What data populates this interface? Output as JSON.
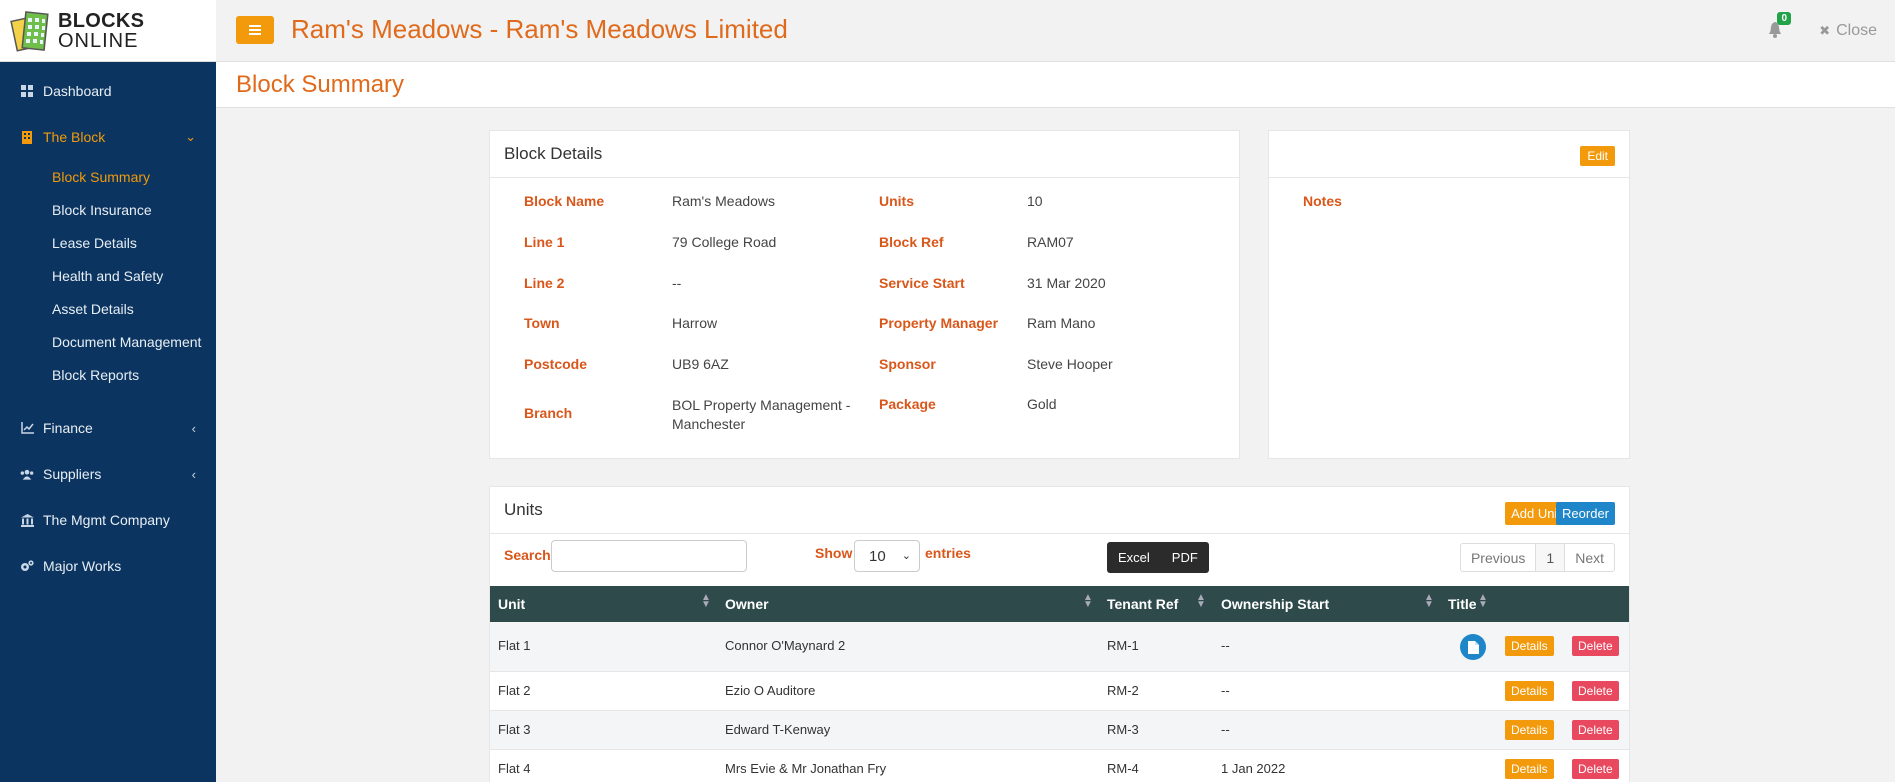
{
  "logo": {
    "line1": "BLOCKS",
    "line2": "ONLINE"
  },
  "sidebar": {
    "dashboard": "Dashboard",
    "the_block": "The Block",
    "sub_items": [
      "Block Summary",
      "Block Insurance",
      "Lease Details",
      "Health and Safety",
      "Asset Details",
      "Document Management",
      "Block Reports"
    ],
    "finance": "Finance",
    "suppliers": "Suppliers",
    "mgmt_company": "The Mgmt Company",
    "major_works": "Major Works"
  },
  "topbar": {
    "title": "Ram's Meadows - Ram's Meadows Limited",
    "notification_count": "0",
    "close_label": "Close"
  },
  "page": {
    "title": "Block Summary"
  },
  "block_details": {
    "heading": "Block Details",
    "labels": {
      "block_name": "Block Name",
      "line1": "Line 1",
      "line2": "Line 2",
      "town": "Town",
      "postcode": "Postcode",
      "branch": "Branch",
      "units": "Units",
      "block_ref": "Block Ref",
      "service_start": "Service Start",
      "property_manager": "Property Manager",
      "sponsor": "Sponsor",
      "package": "Package"
    },
    "values": {
      "block_name": "Ram's Meadows",
      "line1": "79 College Road",
      "line2": "--",
      "town": "Harrow",
      "postcode": "UB9 6AZ",
      "branch": "BOL Property Management - Manchester",
      "units": "10",
      "block_ref": "RAM07",
      "service_start": "31 Mar 2020",
      "property_manager": "Ram Mano",
      "sponsor": "Steve Hooper",
      "package": "Gold"
    }
  },
  "notes": {
    "edit_label": "Edit",
    "label": "Notes"
  },
  "units_panel": {
    "heading": "Units",
    "add_unit": "Add Unit",
    "reorder": "Reorder",
    "search_label": "Search",
    "search_value": "",
    "show_label": "Show",
    "show_value": "10",
    "entries_label": "entries",
    "excel": "Excel",
    "pdf": "PDF",
    "pager": {
      "previous": "Previous",
      "page": "1",
      "next": "Next"
    },
    "columns": [
      "Unit",
      "Owner",
      "Tenant Ref",
      "Ownership Start",
      "Title"
    ],
    "rows": [
      {
        "unit": "Flat 1",
        "owner": "Connor O'Maynard 2",
        "tenant_ref": "RM-1",
        "ownership_start": "--"
      },
      {
        "unit": "Flat 2",
        "owner": "Ezio O Auditore",
        "tenant_ref": "RM-2",
        "ownership_start": "--"
      },
      {
        "unit": "Flat 3",
        "owner": "Edward T-Kenway",
        "tenant_ref": "RM-3",
        "ownership_start": "--"
      },
      {
        "unit": "Flat 4",
        "owner": "Mrs Evie & Mr Jonathan Fry",
        "tenant_ref": "RM-4",
        "ownership_start": "1 Jan 2022"
      }
    ],
    "details_label": "Details",
    "delete_label": "Delete"
  },
  "colors": {
    "accent": "#f29a0b",
    "title": "#e06a1c",
    "sidebar": "#0b3560",
    "primary": "#1e86c9",
    "danger": "#e8495f"
  }
}
